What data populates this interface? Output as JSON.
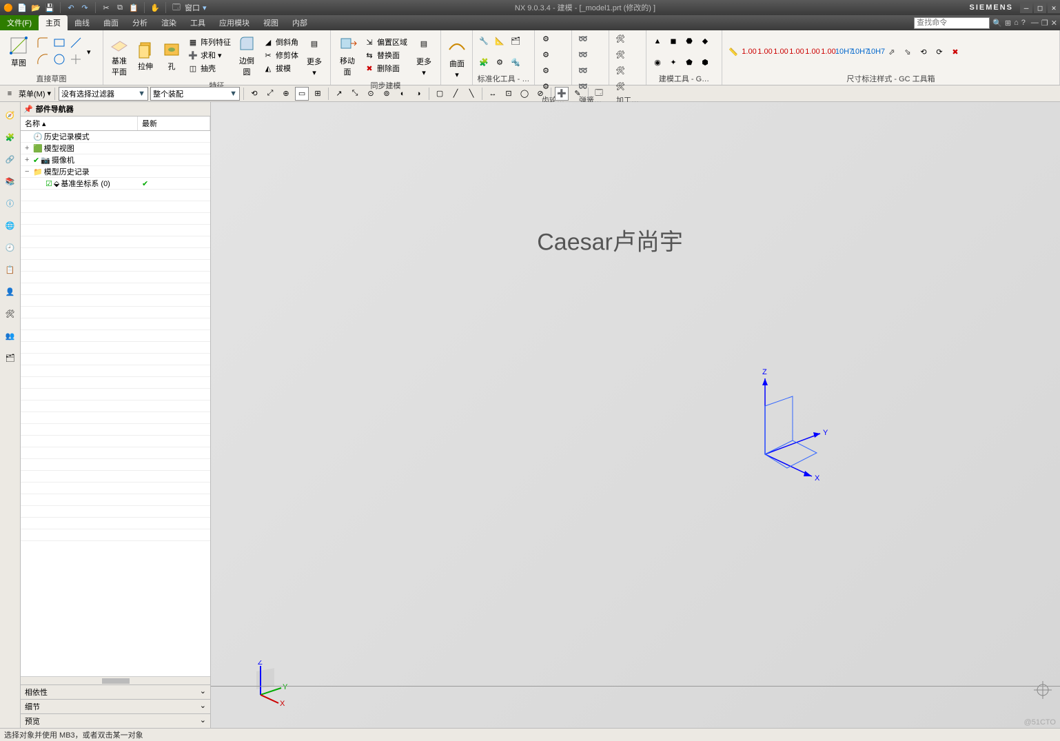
{
  "titlebar": {
    "window_menu": "窗口",
    "title": "NX 9.0.3.4 - 建模 - [_model1.prt  (修改的) ]",
    "brand": "SIEMENS"
  },
  "menubar": {
    "file": "文件(F)",
    "tabs": [
      "主页",
      "曲线",
      "曲面",
      "分析",
      "渲染",
      "工具",
      "应用模块",
      "视图",
      "内部"
    ],
    "active_index": 0,
    "search_placeholder": "查找命令"
  },
  "ribbon": {
    "groups": {
      "sketch": {
        "label": "直接草图",
        "btn": "草图"
      },
      "feature": {
        "label": "特征",
        "datum": "基准平面",
        "extrude": "拉伸",
        "hole": "孔",
        "pattern": "阵列特征",
        "union": "求和",
        "shell": "抽壳",
        "edge": "边倒圆",
        "chamfer": "倒斜角",
        "trim": "修剪体",
        "draft": "拔模",
        "more": "更多"
      },
      "sync": {
        "label": "同步建模",
        "move": "移动面",
        "offset": "偏置区域",
        "replace": "替换面",
        "delete": "删除面",
        "more": "更多"
      },
      "surf": {
        "label": "",
        "btn": "曲面"
      },
      "std": {
        "label": "标准化工具 - …"
      },
      "gear": {
        "label": "齿轮…"
      },
      "spring": {
        "label": "弹簧…"
      },
      "machining": {
        "label": "加工…"
      },
      "modeling": {
        "label": "建模工具 - G…"
      },
      "dim": {
        "label": "尺寸标注样式 - GC 工具箱"
      }
    }
  },
  "toolbar2": {
    "menu_btn": "菜单(M)",
    "filter": "没有选择过滤器",
    "assembly": "整个装配"
  },
  "nav": {
    "title": "部件导航器",
    "col1": "名称",
    "col2": "最新",
    "rows": [
      {
        "indent": 0,
        "icon": "clock",
        "text": "历史记录模式",
        "check": ""
      },
      {
        "indent": 0,
        "icon": "cube-green",
        "text": "模型视图",
        "check": "",
        "expand": "+"
      },
      {
        "indent": 0,
        "icon": "camera",
        "text": "摄像机",
        "check": "✔",
        "expand": "+",
        "checkcolor": "#0a0"
      },
      {
        "indent": 0,
        "icon": "folder",
        "text": "模型历史记录",
        "check": "",
        "expand": "−"
      },
      {
        "indent": 1,
        "icon": "csys",
        "text": "基准坐标系 (0)",
        "check": "✔",
        "boxcheck": true
      }
    ],
    "sections": [
      "相依性",
      "细节",
      "预览"
    ]
  },
  "viewport": {
    "watermark": "Caesar卢尚宇",
    "corner_watermark": "@51CTO"
  },
  "status": "选择对象并使用 MB3，或者双击某一对象"
}
